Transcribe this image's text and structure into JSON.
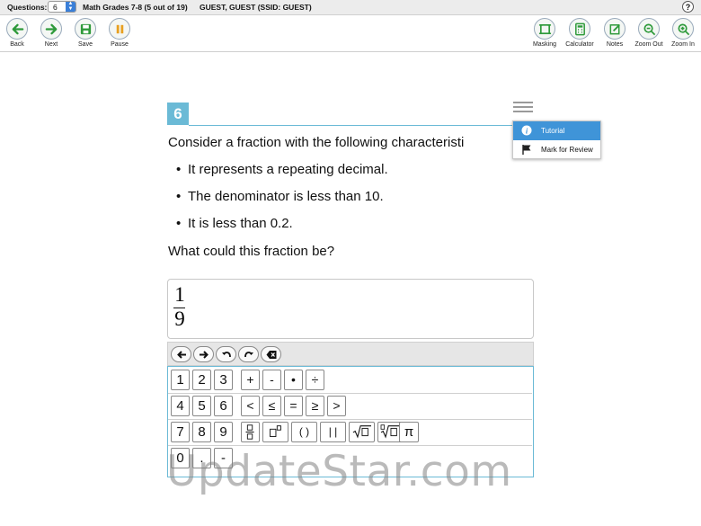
{
  "topbar": {
    "questions_label": "Questions:",
    "questions_value": "6",
    "course_title": "Math Grades 7-8 (5 out of 19)",
    "user": "GUEST, GUEST (SSID: GUEST)",
    "help": "?"
  },
  "toolbar": {
    "back": "Back",
    "next": "Next",
    "save": "Save",
    "pause": "Pause",
    "masking": "Masking",
    "calculator": "Calculator",
    "notes": "Notes",
    "zoom_out": "Zoom Out",
    "zoom_in": "Zoom In"
  },
  "question": {
    "number": "6",
    "prompt": "Consider a fraction with the following characteristi",
    "bullets": [
      "It represents a repeating decimal.",
      "The denominator is less than 10.",
      "It is less than 0.2."
    ],
    "ask": "What could this fraction be?"
  },
  "menu": {
    "tutorial": "Tutorial",
    "mark_for_review": "Mark for Review"
  },
  "answer": {
    "numerator": "1",
    "denominator": "9"
  },
  "keypad": {
    "row1": [
      "1",
      "2",
      "3",
      "+",
      "-",
      "•",
      "÷"
    ],
    "row2": [
      "4",
      "5",
      "6",
      "<",
      "≤",
      "=",
      "≥",
      ">"
    ],
    "row3": [
      "7",
      "8",
      "9"
    ],
    "row3_templates": [
      "□⁄□",
      "□□",
      "( )",
      "| |",
      "√□",
      "ⁿ√□",
      "π"
    ],
    "row4": [
      "0",
      ".",
      "-"
    ]
  },
  "watermark": "UpdateStar.com",
  "colors": {
    "accent_blue": "#6bbad6",
    "menu_highlight": "#3f94d8",
    "green_icon": "#2e9a3a",
    "orange_icon": "#e8a020"
  }
}
